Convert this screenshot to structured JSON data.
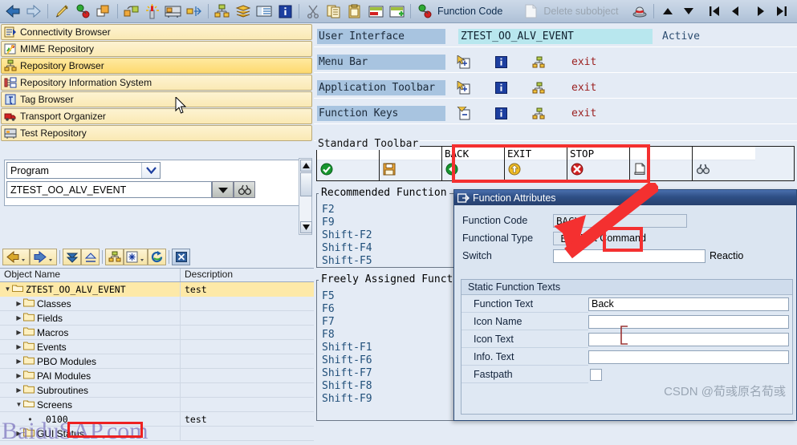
{
  "toolbar": {
    "icons": [
      {
        "name": "back-arrow-icon"
      },
      {
        "name": "forward-arrow-icon"
      },
      {
        "name": "edit-pencil-icon"
      },
      {
        "name": "activate-object-icon"
      },
      {
        "name": "display-object-icon"
      },
      {
        "name": "where-used-list-icon"
      },
      {
        "name": "new-object-icon"
      },
      {
        "name": "testing-tools-icon"
      },
      {
        "name": "debugger-icon"
      },
      {
        "name": "object-navigator-icon"
      },
      {
        "name": "layers-icon"
      },
      {
        "name": "list-icon"
      },
      {
        "name": "information-icon"
      },
      {
        "name": "cut-icon"
      },
      {
        "name": "copy-icon"
      },
      {
        "name": "paste-icon"
      },
      {
        "name": "insert-row-icon"
      },
      {
        "name": "append-row-icon"
      }
    ],
    "function_code_icon": "function-code-icon",
    "function_code_label": "Function Code",
    "delete_subobject_icon": "blank-page-icon",
    "delete_subobject_label": "Delete subobject",
    "hat_icon": "technical-info-icon",
    "nav_icons": [
      {
        "name": "sort-up-icon"
      },
      {
        "name": "sort-down-icon"
      },
      {
        "name": "first-page-icon"
      },
      {
        "name": "previous-page-icon"
      },
      {
        "name": "next-page-icon"
      },
      {
        "name": "last-page-icon"
      }
    ]
  },
  "sidebar": {
    "items": [
      {
        "label": "Connectivity Browser",
        "icon": "connectivity-browser-icon",
        "selected": false
      },
      {
        "label": "MIME Repository",
        "icon": "mime-repository-icon",
        "selected": false
      },
      {
        "label": "Repository Browser",
        "icon": "repository-browser-icon",
        "selected": true
      },
      {
        "label": "Repository Information System",
        "icon": "repository-info-icon",
        "selected": false
      },
      {
        "label": "Tag Browser",
        "icon": "tag-browser-icon",
        "selected": false
      },
      {
        "label": "Transport Organizer",
        "icon": "transport-organizer-icon",
        "selected": false
      },
      {
        "label": "Test Repository",
        "icon": "test-repository-icon",
        "selected": false
      }
    ]
  },
  "object_selector": {
    "type_value": "Program",
    "type_arrow_icon": "chevron-down-icon",
    "name_value": "ZTEST_OO_ALV_EVENT",
    "name_dropdown_icon": "dropdown-triangle-icon",
    "search_icon": "binoculars-icon"
  },
  "tree_toolbar": {
    "buttons": [
      {
        "name": "back-history-button",
        "icon": "yellow-left-arrow-icon"
      },
      {
        "name": "forward-history-button",
        "icon": "yellow-right-arrow-icon"
      },
      {
        "name": "expand-all-button",
        "icon": "expand-down-icon"
      },
      {
        "name": "collapse-all-button",
        "icon": "collapse-up-icon"
      },
      {
        "name": "object-list-button",
        "icon": "hierarchy-icon"
      },
      {
        "name": "new-object-button",
        "icon": "asterisk-icon"
      },
      {
        "name": "refresh-button",
        "icon": "refresh-icon"
      },
      {
        "name": "close-button",
        "icon": "blue-x-icon"
      }
    ]
  },
  "tree": {
    "columns": [
      "Object Name",
      "Description"
    ],
    "rows": [
      {
        "label": "ZTEST_OO_ALV_EVENT",
        "desc": "test",
        "indent": 0,
        "twist": "down",
        "icon": "open-folder-icon",
        "selected": true
      },
      {
        "label": "Classes",
        "desc": "",
        "indent": 1,
        "twist": "right",
        "icon": "folder-icon",
        "selected": false
      },
      {
        "label": "Fields",
        "desc": "",
        "indent": 1,
        "twist": "right",
        "icon": "folder-icon",
        "selected": false
      },
      {
        "label": "Macros",
        "desc": "",
        "indent": 1,
        "twist": "right",
        "icon": "folder-icon",
        "selected": false
      },
      {
        "label": "Events",
        "desc": "",
        "indent": 1,
        "twist": "right",
        "icon": "folder-icon",
        "selected": false
      },
      {
        "label": "PBO Modules",
        "desc": "",
        "indent": 1,
        "twist": "right",
        "icon": "folder-icon",
        "selected": false
      },
      {
        "label": "PAI Modules",
        "desc": "",
        "indent": 1,
        "twist": "right",
        "icon": "folder-icon",
        "selected": false
      },
      {
        "label": "Subroutines",
        "desc": "",
        "indent": 1,
        "twist": "right",
        "icon": "folder-icon",
        "selected": false
      },
      {
        "label": "Screens",
        "desc": "",
        "indent": 1,
        "twist": "down",
        "icon": "open-folder-icon",
        "selected": false
      },
      {
        "label": "0100",
        "desc": "test",
        "indent": 2,
        "twist": "leaf",
        "icon": "",
        "selected": false
      },
      {
        "label": "GUI Status",
        "desc": "",
        "indent": 1,
        "twist": "right",
        "icon": "folder-icon",
        "selected": false
      }
    ]
  },
  "watermark_left": {
    "part1": "Baidu",
    "part2": "SAP",
    "part3": ".com"
  },
  "interface": {
    "rows": [
      {
        "label": "User Interface",
        "value": "ZTEST_OO_ALV_EVENT",
        "status": "Active"
      },
      {
        "label": "Menu Bar",
        "cmd": "exit",
        "icons": [
          "expand-node-icon",
          "information-icon",
          "hierarchy-icon"
        ]
      },
      {
        "label": "Application Toolbar",
        "cmd": "exit",
        "icons": [
          "expand-node-icon",
          "information-icon",
          "hierarchy-icon"
        ]
      },
      {
        "label": "Function Keys",
        "cmd": "exit",
        "icons": [
          "collapse-node-icon",
          "information-icon",
          "hierarchy-icon"
        ]
      }
    ]
  },
  "standard_toolbar": {
    "group_label": "Standard Toolbar",
    "cells": [
      {
        "caption": "",
        "icon": "green-check-icon",
        "highlighted": false
      },
      {
        "caption": "",
        "icon": "save-disk-icon",
        "highlighted": false
      },
      {
        "caption": "BACK",
        "icon": "green-back-icon",
        "highlighted": true
      },
      {
        "caption": "EXIT",
        "icon": "yellow-exit-icon",
        "highlighted": true
      },
      {
        "caption": "STOP",
        "icon": "red-cancel-icon",
        "highlighted": true
      },
      {
        "caption": "",
        "icon": "print-icon",
        "highlighted": false
      },
      {
        "caption": "",
        "icon": "find-icon",
        "highlighted": false
      }
    ]
  },
  "recommended_keys": {
    "title": "Recommended Function",
    "keys": [
      "F2",
      "F9",
      "Shift-F2",
      "Shift-F4",
      "Shift-F5"
    ]
  },
  "freely_assigned_keys": {
    "title": "Freely Assigned Funct",
    "keys": [
      "F5",
      "F6",
      "F7",
      "F8",
      "Shift-F1",
      "Shift-F6",
      "Shift-F7",
      "Shift-F8",
      "Shift-F9"
    ]
  },
  "dialog": {
    "title": "Function Attributes",
    "title_icon": "dialog-window-icon",
    "function_code_label": "Function Code",
    "function_code_value": "BACK",
    "functional_type_label": "Functional Type",
    "functional_type_value": "E",
    "functional_type_desc": "Exit Command",
    "switch_label": "Switch",
    "switch_value": "",
    "reaction_label": "Reactio",
    "static_texts": {
      "group_title": "Static Function Texts",
      "fields": [
        {
          "label": "Function Text",
          "value": "Back",
          "type": "text"
        },
        {
          "label": "Icon Name",
          "value": "",
          "type": "text"
        },
        {
          "label": "Icon Text",
          "value": "",
          "type": "text"
        },
        {
          "label": "Info. Text",
          "value": "",
          "type": "text"
        },
        {
          "label": "Fastpath",
          "value": "",
          "type": "checkbox"
        }
      ]
    }
  },
  "watermark_right": "CSDN @荀彧原名荀彧"
}
